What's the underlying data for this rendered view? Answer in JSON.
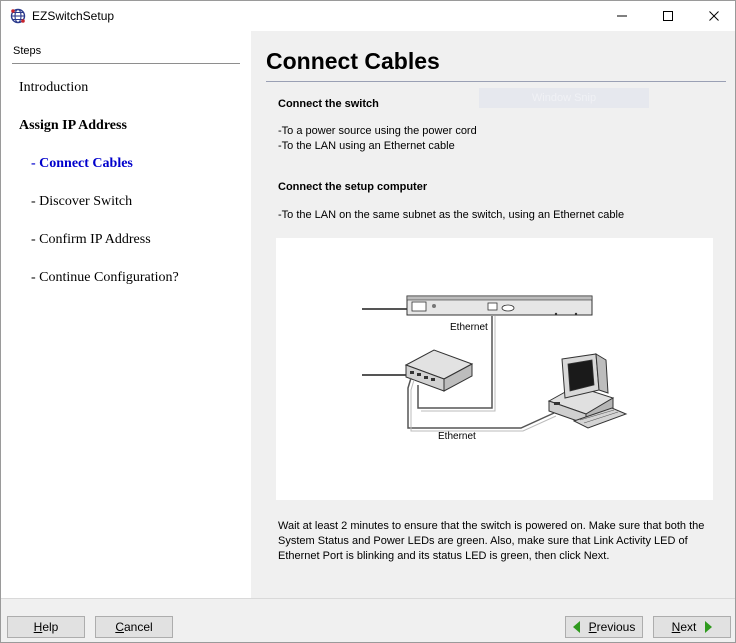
{
  "window": {
    "title": "EZSwitchSetup",
    "icon": "globe-icon"
  },
  "sidebar": {
    "steps_label": "Steps",
    "items": [
      {
        "label": "Introduction"
      },
      {
        "label": "Assign IP Address"
      },
      {
        "label": "- Connect Cables"
      },
      {
        "label": "- Discover Switch"
      },
      {
        "label": "- Confirm IP Address"
      },
      {
        "label": "- Continue Configuration?"
      }
    ]
  },
  "main": {
    "title": "Connect Cables",
    "ghost_text": "Window Snip",
    "section1": {
      "heading": "Connect the switch",
      "lines": [
        "-To a power source using the power cord",
        "-To the LAN using an Ethernet cable"
      ]
    },
    "section2": {
      "heading": "Connect the setup computer",
      "lines": [
        "-To the LAN on the same subnet as the switch, using an Ethernet cable"
      ]
    },
    "diagram": {
      "label_top": "Ethernet",
      "label_bottom": "Ethernet"
    },
    "wait_lines": [
      "Wait at least 2 minutes to ensure that the switch is powered on. Make sure that both the",
      "System Status and Power LEDs are green. Also, make sure that Link Activity LED of",
      "Ethernet Port is blinking and its status LED is green, then click Next."
    ]
  },
  "buttons": {
    "help": {
      "prefix": "",
      "accel": "H",
      "rest": "elp"
    },
    "cancel": {
      "prefix": "",
      "accel": "C",
      "rest": "ancel"
    },
    "previous": {
      "prefix": "",
      "accel": "P",
      "rest": "revious"
    },
    "next": {
      "prefix": "",
      "accel": "N",
      "rest": "ext"
    }
  },
  "colors": {
    "active_step": "#0000cc",
    "nav_arrow": "#2f9a1e"
  }
}
